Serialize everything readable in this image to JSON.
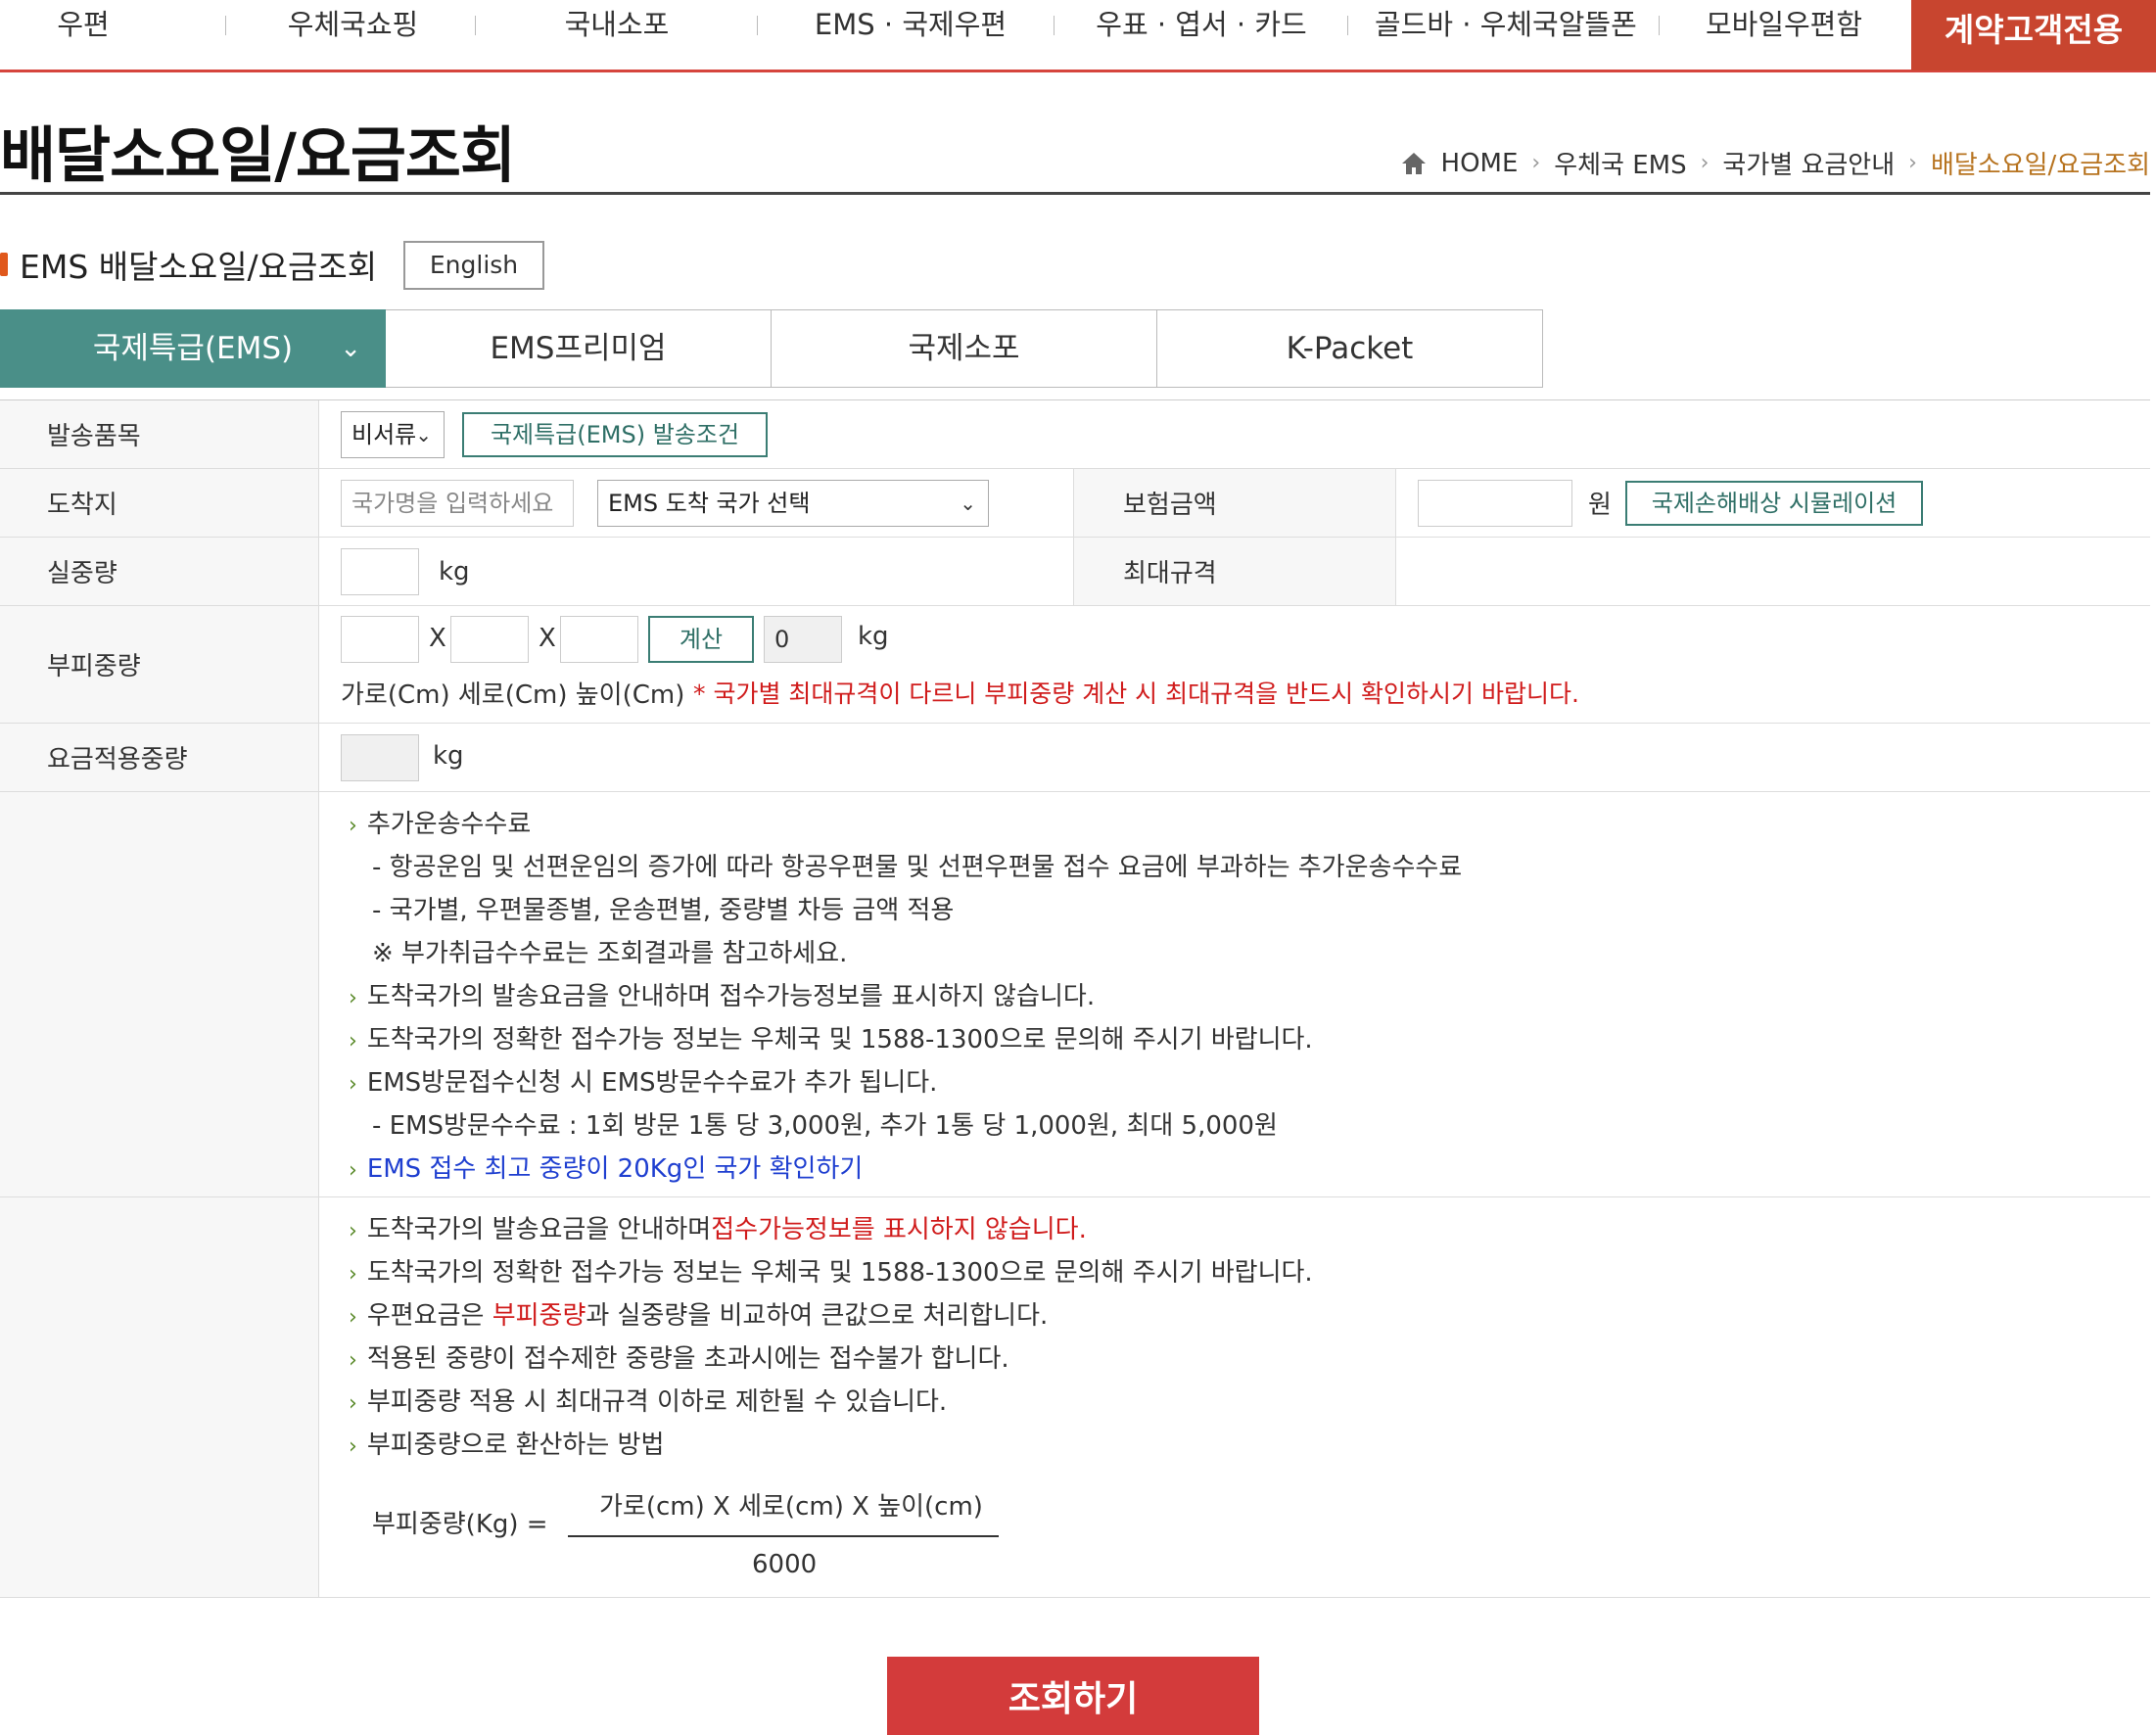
{
  "nav": {
    "items": [
      "우편",
      "우체국쇼핑",
      "국내소포",
      "EMS · 국제우편",
      "우표 · 엽서 · 카드",
      "골드바 · 우체국알뜰폰",
      "모바일우편함"
    ],
    "contract": "계약고객전용"
  },
  "page": {
    "title": "배달소요일/요금조회",
    "breadcrumb": [
      "HOME",
      "우체국 EMS",
      "국가별 요금안내",
      "배달소요일/요금조회"
    ]
  },
  "section": {
    "title": "EMS 배달소요일/요금조회",
    "english_label": "English"
  },
  "tabs": [
    "국제특급(EMS)",
    "EMS프리미엄",
    "국제소포",
    "K-Packet"
  ],
  "form": {
    "item_label": "발송품목",
    "item_select": "비서류",
    "item_condition_btn": "국제특급(EMS) 발송조건",
    "dest_label": "도착지",
    "dest_placeholder": "국가명을 입력하세요",
    "dest_select": "EMS 도착 국가 선택",
    "insurance_label": "보험금액",
    "insurance_unit": "원",
    "insurance_sim_btn": "국제손해배상 시뮬레이션",
    "weight_label": "실중량",
    "weight_unit": "kg",
    "maxsize_label": "최대규격",
    "volume_label": "부피중량",
    "x_sep": "X",
    "calc_btn": "계산",
    "volume_value": "0",
    "volume_unit": "kg",
    "dims_caption": "가로(Cm) 세로(Cm) 높이(Cm)",
    "dims_warning": "* 국가별 최대규격이 다르니 부피중량 계산 시 최대규격을 반드시 확인하시기 바랍니다.",
    "charge_weight_label": "요금적용중량",
    "charge_weight_unit": "kg"
  },
  "notes1": {
    "l1": "추가운송수수료",
    "l2": "- 항공운임 및 선편운임의 증가에 따라 항공우편물 및 선편우편물 접수 요금에 부과하는 추가운송수수료",
    "l3": "- 국가별, 우편물종별, 운송편별, 중량별 차등 금액 적용",
    "l4": "※ 부가취급수수료는 조회결과를 참고하세요.",
    "l5": "도착국가의 발송요금을 안내하며 접수가능정보를 표시하지 않습니다.",
    "l6": "도착국가의 정확한 접수가능 정보는 우체국 및 1588-1300으로 문의해 주시기 바랍니다.",
    "l7": "EMS방문접수신청 시 EMS방문수수료가 추가 됩니다.",
    "l8": "- EMS방문수수료 : 1회 방문 1통 당 3,000원, 추가 1통 당 1,000원, 최대 5,000원",
    "l9": "EMS 접수 최고 중량이 20Kg인 국가 확인하기"
  },
  "notes2": {
    "l1a": "도착국가의 발송요금을 안내하며",
    "l1b": "접수가능정보를 표시하지 않습니다.",
    "l2": "도착국가의 정확한 접수가능 정보는 우체국 및 1588-1300으로 문의해 주시기 바랍니다.",
    "l3a": "우편요금은 ",
    "l3b": "부피중량",
    "l3c": "과 실중량을 비교하여 큰값으로 처리합니다.",
    "l4": "적용된 중량이 접수제한 중량을 초과시에는 접수불가 합니다.",
    "l5": "부피중량 적용 시 최대규격 이하로 제한될 수 있습니다.",
    "l6": "부피중량으로 환산하는 방법",
    "formula_left": "부피중량(Kg) =",
    "formula_num": "가로(cm) X 세로(cm) X 높이(cm)",
    "formula_den": "6000"
  },
  "submit": "조회하기",
  "colors": {
    "accent_red": "#c8452f",
    "tab_teal": "#4a8f88",
    "warning_red": "#d01c1c",
    "link_blue": "#1f3fd0",
    "submit_red": "#d33b3b"
  }
}
